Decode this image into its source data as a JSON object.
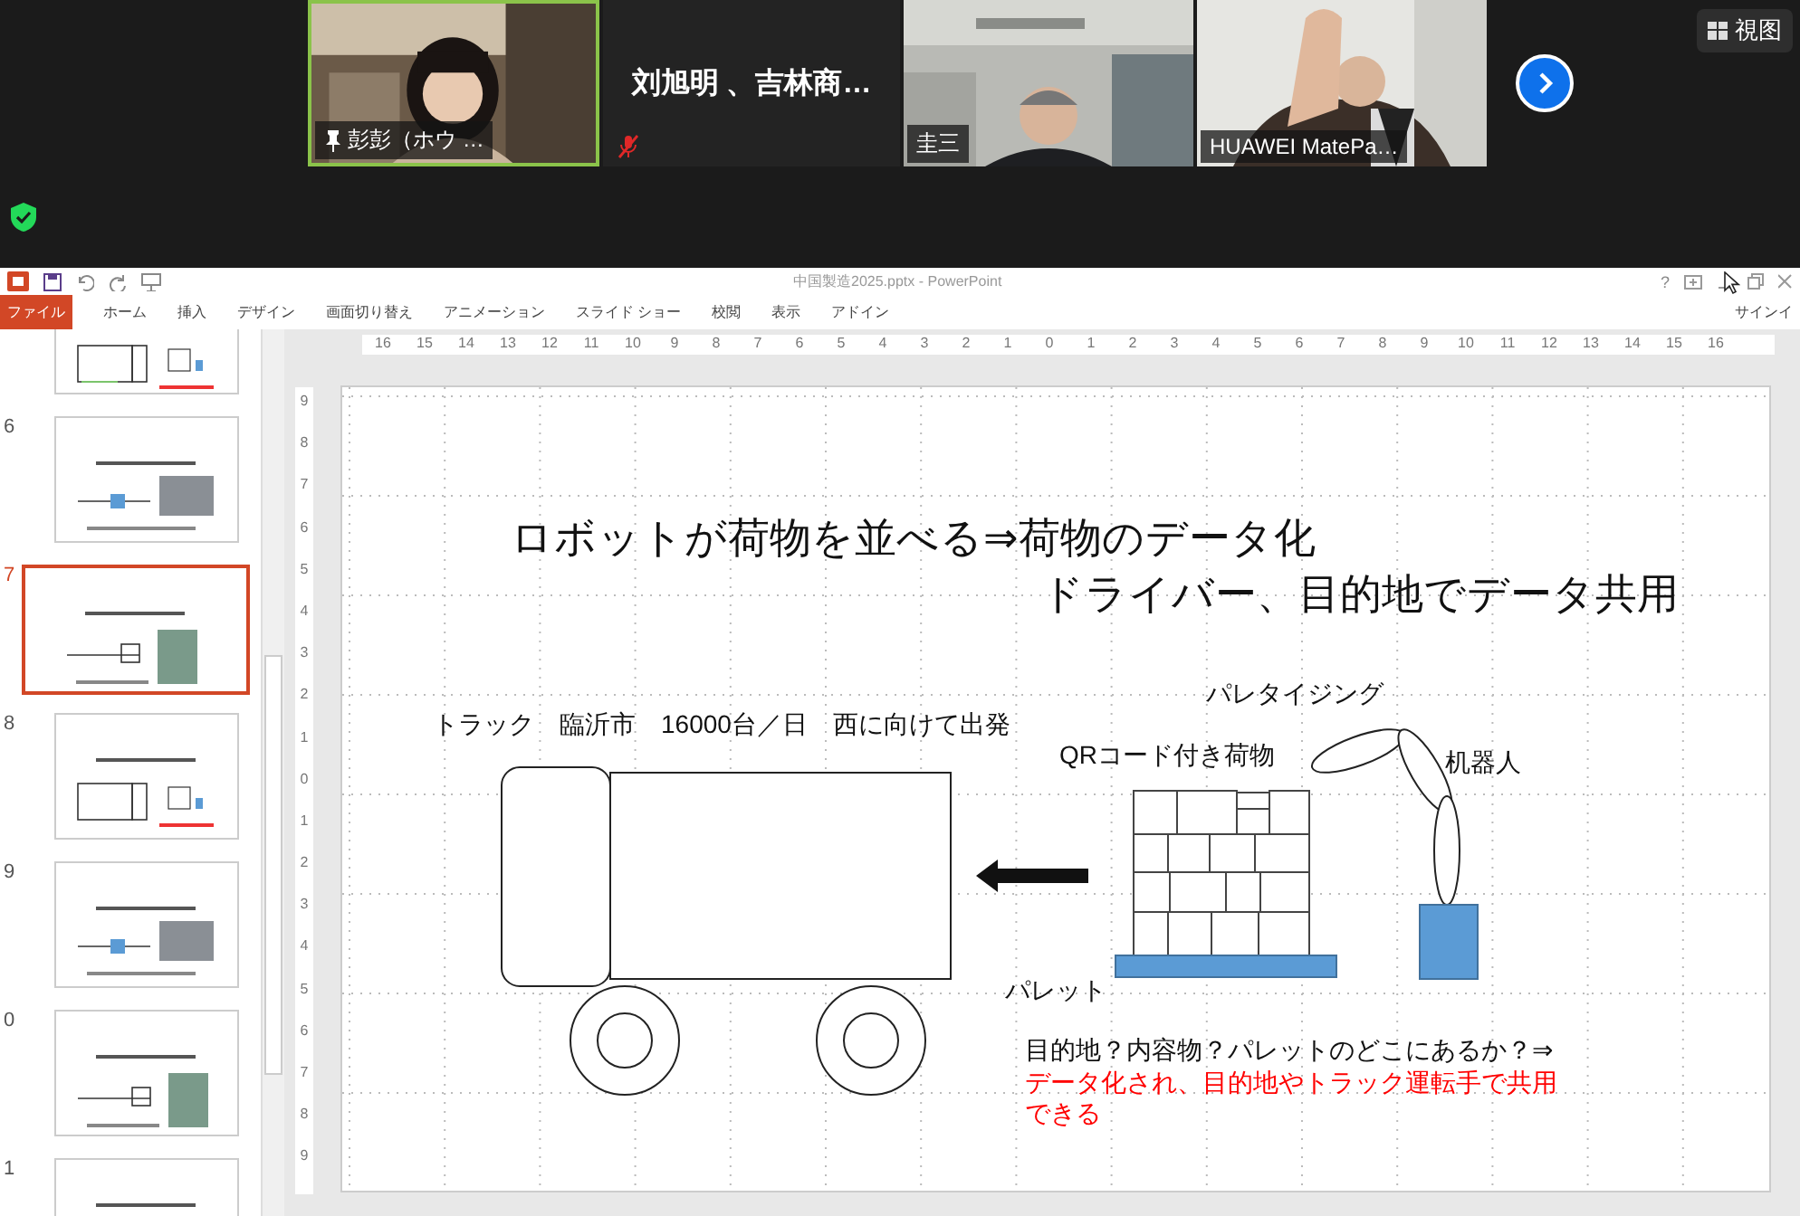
{
  "meeting": {
    "participants": [
      {
        "kind": "video",
        "name": "彭彭（ホウ …",
        "pinned": true,
        "speaking": true,
        "muted": false
      },
      {
        "kind": "name",
        "name": "刘旭明 、吉林商…",
        "pinned": false,
        "speaking": false,
        "muted": true
      },
      {
        "kind": "video",
        "name": "圭三",
        "pinned": false,
        "speaking": false,
        "muted": false
      },
      {
        "kind": "video",
        "name": "HUAWEI MatePa…",
        "pinned": false,
        "speaking": false,
        "muted": false
      }
    ],
    "view_button": "視图"
  },
  "window": {
    "title": "中国製造2025.pptx - PowerPoint",
    "help": "?",
    "account": "サインイ"
  },
  "ribbon_tabs": [
    {
      "label": "ファイル",
      "kind": "file"
    },
    {
      "label": "ホーム",
      "kind": "tab"
    },
    {
      "label": "挿入",
      "kind": "tab"
    },
    {
      "label": "デザイン",
      "kind": "tab"
    },
    {
      "label": "画面切り替え",
      "kind": "tab"
    },
    {
      "label": "アニメーション",
      "kind": "tab"
    },
    {
      "label": "スライド ショー",
      "kind": "tab"
    },
    {
      "label": "校閲",
      "kind": "tab"
    },
    {
      "label": "表示",
      "kind": "tab"
    },
    {
      "label": "アドイン",
      "kind": "tab"
    }
  ],
  "thumbnails": [
    {
      "selected": false
    },
    {
      "number": "6",
      "selected": false
    },
    {
      "number": "7",
      "selected": true
    },
    {
      "number": "8",
      "selected": false
    },
    {
      "number": "9",
      "selected": false
    },
    {
      "number": "0",
      "selected": false
    },
    {
      "number": "1",
      "selected": false
    }
  ],
  "ruler": {
    "horizontal": [
      "16",
      "15",
      "14",
      "13",
      "12",
      "11",
      "10",
      "9",
      "8",
      "7",
      "6",
      "5",
      "4",
      "3",
      "2",
      "1",
      "0",
      "1",
      "2",
      "3",
      "4",
      "5",
      "6",
      "7",
      "8",
      "9",
      "10",
      "11",
      "12",
      "13",
      "14",
      "15",
      "16"
    ],
    "vertical": [
      "9",
      "8",
      "7",
      "6",
      "5",
      "4",
      "3",
      "2",
      "1",
      "0",
      "1",
      "2",
      "3",
      "4",
      "5",
      "6",
      "7",
      "8",
      "9"
    ]
  },
  "slide": {
    "heading": [
      "ロボットが荷物を並べる⇒荷物のデータ化",
      "ドライバー、目的地でデータ共用"
    ],
    "truck_caption": "トラック　臨沂市　16000台／日　西に向けて出発",
    "palletizing_caption": "パレタイジング",
    "cargo_caption": "QRコード付き荷物",
    "robot_caption": "机器人",
    "pallet_caption": "パレット",
    "question": "目的地？内容物？パレットのどこにあるか？⇒",
    "answer": "データ化され、目的地やトラック運転手で共用できる"
  }
}
